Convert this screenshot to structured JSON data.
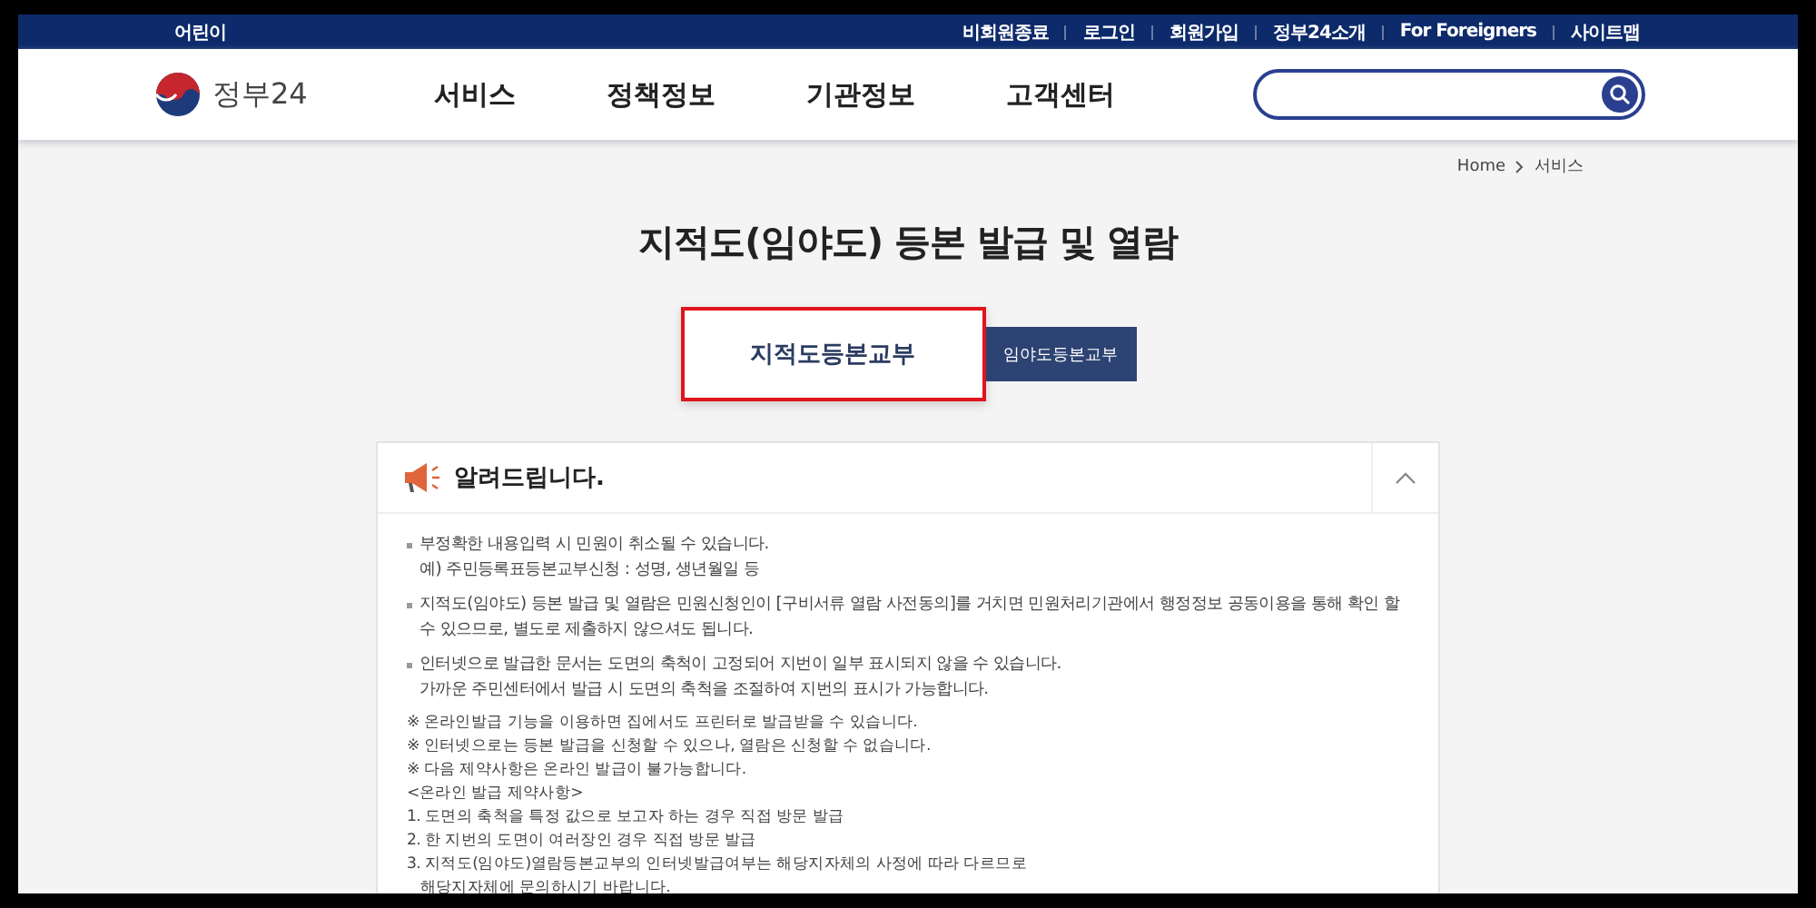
{
  "top_bar": {
    "left_link": "어린이",
    "links": [
      "비회원종료",
      "로그인",
      "회원가입",
      "정부24소개",
      "For Foreigners",
      "사이트맵"
    ]
  },
  "header": {
    "logo_text": "정부24",
    "nav": [
      "서비스",
      "정책정보",
      "기관정보",
      "고객센터"
    ]
  },
  "breadcrumb": [
    "Home",
    "서비스"
  ],
  "page_title": "지적도(임야도) 등본 발급 및 열람",
  "tabs": [
    {
      "label": "지적도등본교부",
      "selected": true
    },
    {
      "label": "임야도등본교부",
      "selected": false
    }
  ],
  "notice": {
    "title": "알려드립니다.",
    "expanded": true,
    "items": [
      {
        "kind": "bullet",
        "lines": [
          "부정확한 내용입력 시 민원이 취소될 수 있습니다.",
          "예) 주민등록표등본교부신청 : 성명, 생년월일 등"
        ]
      },
      {
        "kind": "bullet",
        "lines": [
          "지적도(임야도) 등본 발급 및 열람은 민원신청인이 [구비서류 열람 사전동의]를 거치면 민원처리기관에서 행정정보 공동이용을 통해 확인 할 수 있으므로, 별도로 제출하지 않으셔도 됩니다."
        ]
      },
      {
        "kind": "bullet",
        "lines": [
          "인터넷으로 발급한 문서는 도면의 축척이 고정되어 지번이 일부 표시되지 않을 수 있습니다.",
          "가까운 주민센터에서 발급 시 도면의 축척을 조절하여 지번의 표시가 가능합니다."
        ]
      },
      {
        "kind": "plain",
        "lines": [
          "※ 온라인발급 기능을 이용하면 집에서도 프린터로 발급받을 수 있습니다.",
          "※ 인터넷으로는 등본 발급을 신청할 수 있으나, 열람은 신청할 수 없습니다.",
          "※ 다음 제약사항은 온라인 발급이 불가능합니다.",
          "<온라인 발급 제약사항>",
          "1. 도면의 축척을 특정 값으로 보고자 하는 경우 직접 방문 발급",
          "2. 한 지번의 도면이 여러장인 경우 직접 방문 발급",
          "3. 지적도(임야도)열람등본교부의 인터넷발급여부는 해당지자체의 사정에 따라 다르므로",
          "   해당지자체에 문의하시기 바랍니다."
        ]
      }
    ]
  }
}
